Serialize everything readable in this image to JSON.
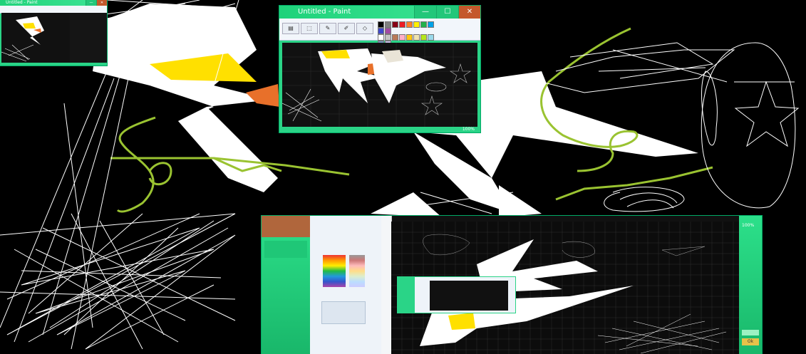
{
  "windows": {
    "top_paint": {
      "title": "Untitled - Paint",
      "controls": [
        "—",
        "☐",
        "✕"
      ],
      "status_right": "100%"
    },
    "small_topleft": {
      "title": "Untitled - Paint",
      "controls": [
        "—",
        "☐",
        "✕"
      ]
    },
    "bottom_window": {
      "right_panel_labels": [
        "100%",
        "Ok"
      ]
    }
  },
  "palette": {
    "colors": [
      "#000000",
      "#7f7f7f",
      "#880015",
      "#ed1c24",
      "#ff7f27",
      "#fff200",
      "#22b14c",
      "#00a2e8",
      "#3f48cc",
      "#a349a4",
      "#ffffff",
      "#c3c3c3",
      "#b97a57",
      "#ffaec9",
      "#ffc90e",
      "#efe4b0",
      "#b5e61d",
      "#99d9ea",
      "#7092be",
      "#c8bfe7"
    ]
  },
  "colors": {
    "accent_green": "#2ad487",
    "accent_orange": "#e8702a",
    "accent_yellow": "#ffe000",
    "stroke_lime": "#9ac331"
  }
}
